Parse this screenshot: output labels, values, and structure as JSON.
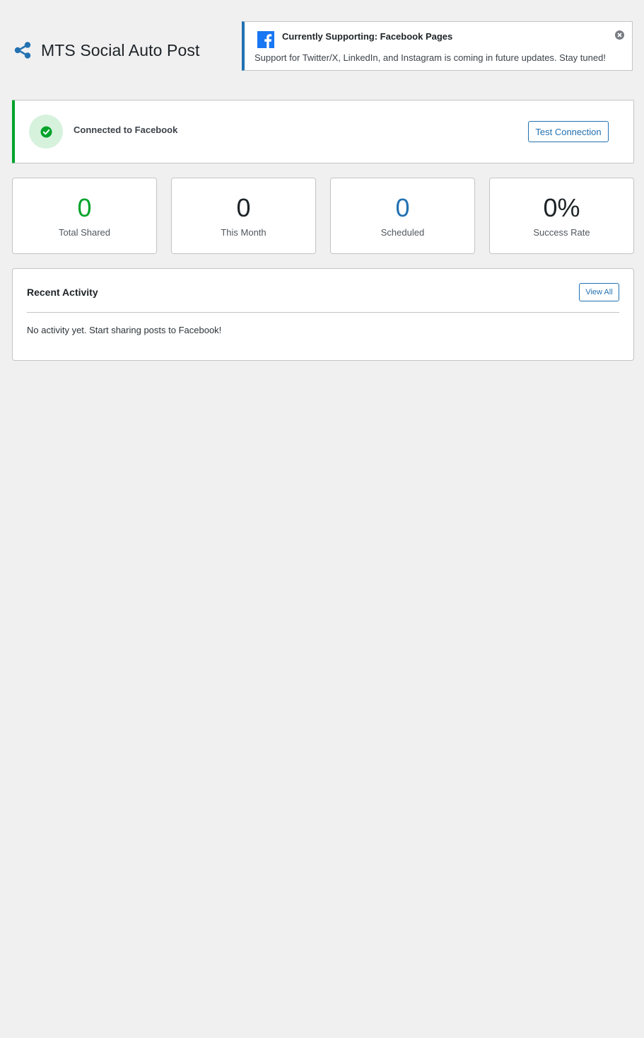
{
  "header": {
    "title": "MTS Social Auto Post",
    "icon": "share-icon"
  },
  "notice": {
    "title": "Currently Supporting: Facebook Pages",
    "text": "Support for Twitter/X, LinkedIn, and Instagram is coming in future updates. Stay tuned!",
    "icon": "facebook-icon",
    "dismiss_icon": "dismiss-icon",
    "accent_color": "#2271b1"
  },
  "connection": {
    "status_text": "Connected to Facebook",
    "test_button_label": "Test Connection",
    "status_color": "#00a32a",
    "icon": "check-circle-icon"
  },
  "stats": [
    {
      "value": "0",
      "label": "Total Shared",
      "color": "#00a32a"
    },
    {
      "value": "0",
      "label": "This Month",
      "color": "#1d2327"
    },
    {
      "value": "0",
      "label": "Scheduled",
      "color": "#2271b1"
    },
    {
      "value": "0%",
      "label": "Success Rate",
      "color": "#1d2327"
    }
  ],
  "activity": {
    "title": "Recent Activity",
    "view_all_label": "View All",
    "empty_text": "No activity yet. Start sharing posts to Facebook!"
  },
  "colors": {
    "background": "#f0f0f1",
    "card": "#ffffff",
    "border": "#c3c4c7",
    "primary": "#2271b1",
    "success": "#00a32a"
  }
}
